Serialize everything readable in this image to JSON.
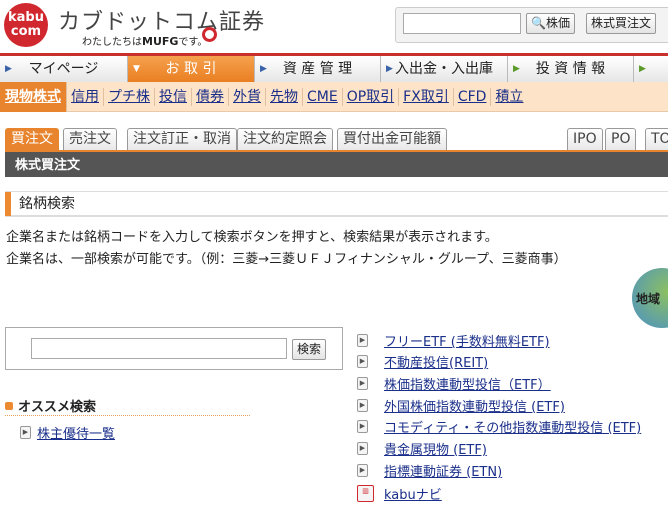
{
  "header": {
    "logo_top": "kabu",
    "logo_bottom": "com",
    "brand": "カブドットコム証券",
    "tagline_pre": "わたしたちは",
    "tagline_bold": "MUFG",
    "tagline_post": "です。",
    "search_value": "",
    "quote_button": "株価",
    "buy_button": "株式買注文"
  },
  "nav": [
    {
      "label": "マイページ"
    },
    {
      "label": "お 取 引"
    },
    {
      "label": "資 産 管 理"
    },
    {
      "label": "入出金・入出庫"
    },
    {
      "label": "投 資 情 報"
    },
    {
      "label": ""
    }
  ],
  "subnav": [
    "現物株式",
    "信用",
    "プチ株",
    "投信",
    "債券",
    "外貨",
    "先物",
    "CME",
    "OP取引",
    "FX取引",
    "CFD",
    "積立"
  ],
  "tabs": [
    "買注文",
    "売注文",
    "注文訂正・取消",
    "注文約定照会",
    "買付出金可能額"
  ],
  "right_tabs": [
    "IPO",
    "PO",
    "TO"
  ],
  "page_title": "株式買注文",
  "section": {
    "title": "銘柄検索",
    "desc1": "企業名または銘柄コードを入力して検索ボタンを押すと、検索結果が表示されます。",
    "desc2": "企業名は、一部検索が可能です。（例：三菱→三菱ＵＦＪフィナンシャル・グループ、三菱商事）",
    "globe": "地域"
  },
  "search": {
    "value": "",
    "button": "検索"
  },
  "recommend": {
    "title": "オススメ検索",
    "links": [
      "株主優待一覧"
    ]
  },
  "links": [
    "フリーETF (手数料無料ETF)",
    "不動産投信(REIT)",
    "株価指数連動型投信（ETF）",
    "外国株価指数連動型投信 (ETF)",
    "コモディティ・その他指数連動型投信 (ETF)",
    "貴金属現物 (ETF)",
    "指標連動証券 (ETN)",
    "kabuナビ"
  ],
  "colors": {
    "brand": "#d0282e",
    "accent": "#e8842d"
  }
}
